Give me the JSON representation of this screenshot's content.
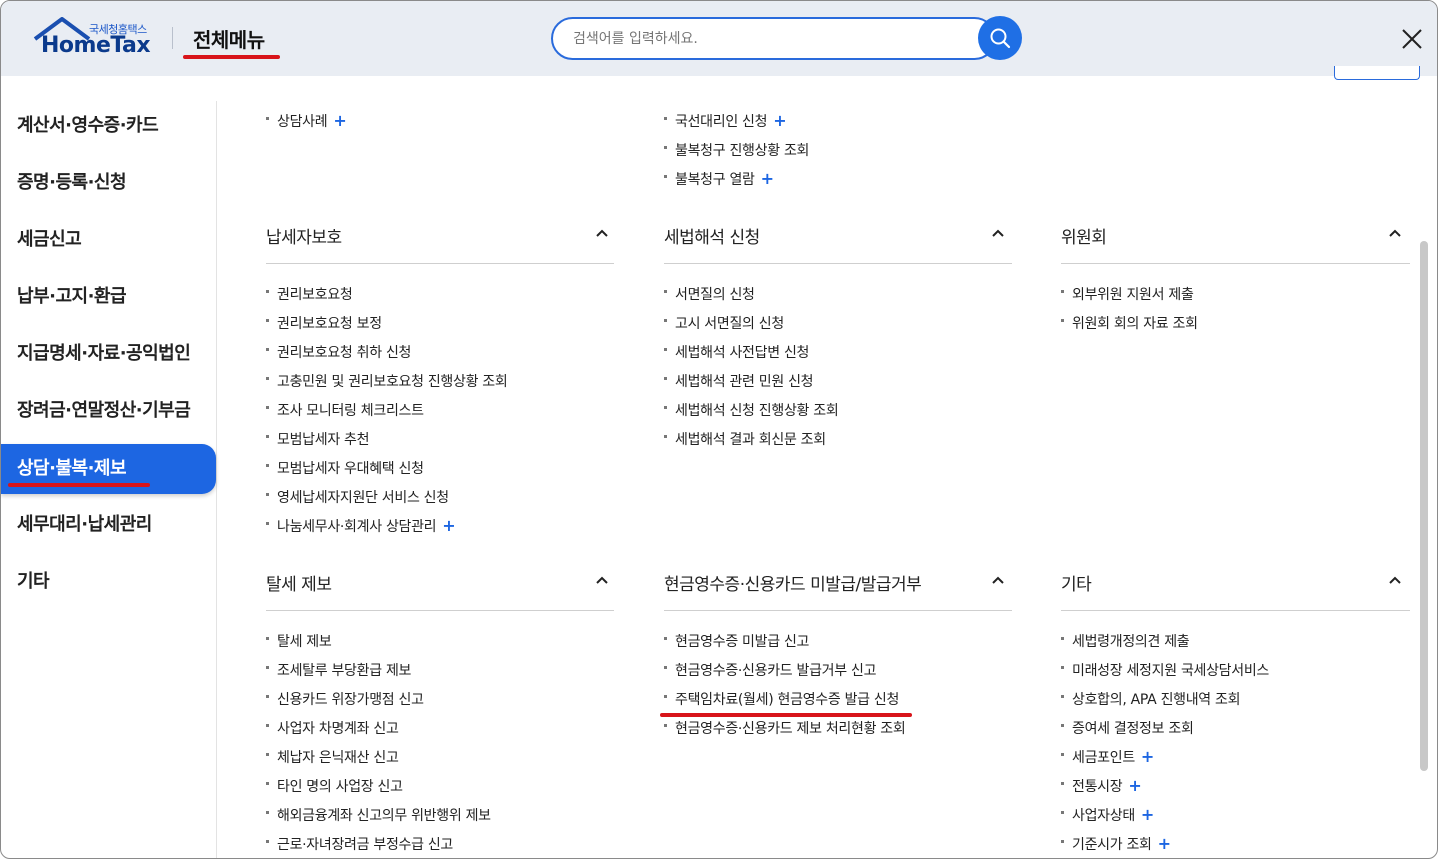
{
  "header": {
    "logo_sub": "국세청홈택스",
    "logo_main": "HomeTax",
    "title": "전체메뉴",
    "search_placeholder": "검색어를 입력하세요.",
    "search_icon": "search-icon",
    "close_icon": "close-icon"
  },
  "colors": {
    "accent": "#1d66e2",
    "annotation": "#d8141a",
    "header_bg": "#e9edf3"
  },
  "sidebar": {
    "items": [
      {
        "label": "계산서·영수증·카드",
        "active": false
      },
      {
        "label": "증명·등록·신청",
        "active": false
      },
      {
        "label": "세금신고",
        "active": false
      },
      {
        "label": "납부·고지·환급",
        "active": false
      },
      {
        "label": "지급명세·자료·공익법인",
        "active": false
      },
      {
        "label": "장려금·연말정산·기부금",
        "active": false
      },
      {
        "label": "상담·불복·제보",
        "active": true
      },
      {
        "label": "세무대리·납세관리",
        "active": false
      },
      {
        "label": "기타",
        "active": false
      }
    ]
  },
  "top_partial": {
    "col1": [
      {
        "label": "상담사례",
        "plus": "+"
      }
    ],
    "col2": [
      {
        "label": "국선대리인 신청",
        "plus": "+"
      },
      {
        "label": "불복청구 진행상황 조회"
      },
      {
        "label": "불복청구 열람",
        "plus": "+"
      }
    ]
  },
  "sections": [
    {
      "title": "납세자보호",
      "items": [
        {
          "label": "권리보호요청"
        },
        {
          "label": "권리보호요청 보정"
        },
        {
          "label": "권리보호요청 취하 신청"
        },
        {
          "label": "고충민원 및 권리보호요청 진행상황 조회"
        },
        {
          "label": "조사 모니터링 체크리스트"
        },
        {
          "label": "모범납세자 추천"
        },
        {
          "label": "모범납세자 우대혜택 신청"
        },
        {
          "label": "영세납세자지원단 서비스 신청"
        },
        {
          "label": "나눔세무사·회계사 상담관리",
          "plus": "+"
        }
      ]
    },
    {
      "title": "세법해석 신청",
      "items": [
        {
          "label": "서면질의 신청"
        },
        {
          "label": "고시 서면질의 신청"
        },
        {
          "label": "세법해석 사전답변 신청"
        },
        {
          "label": "세법해석 관련 민원 신청"
        },
        {
          "label": "세법해석 신청 진행상황 조회"
        },
        {
          "label": "세법해석 결과 회신문 조회"
        }
      ]
    },
    {
      "title": "위원회",
      "items": [
        {
          "label": "외부위원 지원서 제출"
        },
        {
          "label": "위원회 회의 자료 조회"
        }
      ]
    },
    {
      "title": "탈세 제보",
      "items": [
        {
          "label": "탈세 제보"
        },
        {
          "label": "조세탈루 부당환급 제보"
        },
        {
          "label": "신용카드 위장가맹점 신고"
        },
        {
          "label": "사업자 차명계좌 신고"
        },
        {
          "label": "체납자 은닉재산 신고"
        },
        {
          "label": "타인 명의 사업장 신고"
        },
        {
          "label": "해외금융계좌 신고의무 위반행위 제보"
        },
        {
          "label": "근로·자녀장려금 부정수급 신고"
        }
      ]
    },
    {
      "title": "현금영수증·신용카드 미발급/발급거부",
      "items": [
        {
          "label": "현금영수증 미발급 신고"
        },
        {
          "label": "현금영수증·신용카드 발급거부 신고"
        },
        {
          "label": "주택임차료(월세) 현금영수증 발급 신청"
        },
        {
          "label": "현금영수증·신용카드 제보 처리현황 조회"
        }
      ]
    },
    {
      "title": "기타",
      "items": [
        {
          "label": "세법령개정의견 제출"
        },
        {
          "label": "미래성장 세정지원 국세상담서비스"
        },
        {
          "label": "상호합의, APA 진행내역 조회"
        },
        {
          "label": "증여세 결정정보 조회"
        },
        {
          "label": "세금포인트",
          "plus": "+"
        },
        {
          "label": "전통시장",
          "plus": "+"
        },
        {
          "label": "사업자상태",
          "plus": "+"
        },
        {
          "label": "기준시가 조회",
          "plus": "+"
        }
      ]
    }
  ]
}
